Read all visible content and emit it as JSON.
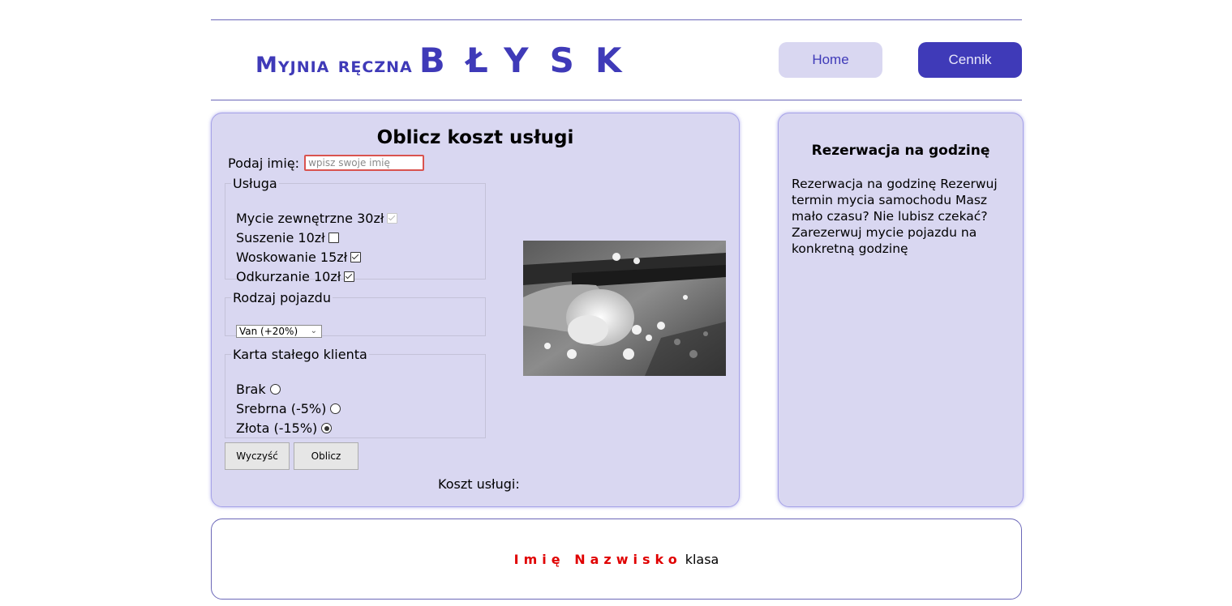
{
  "header": {
    "brand_small": "Myjnia ręczna",
    "brand_big": "BŁYSK",
    "nav": [
      {
        "label": "Home"
      },
      {
        "label": "Cennik"
      }
    ]
  },
  "form": {
    "title": "Oblicz koszt usługi",
    "name_label": "Podaj imię:",
    "name_placeholder": "wpisz swoje imię",
    "name_value": "",
    "services_legend": "Usługa",
    "services": [
      {
        "label": "Mycie zewnętrzne 30zł",
        "checked": true,
        "disabled": true
      },
      {
        "label": "Suszenie 10zł",
        "checked": false,
        "disabled": false
      },
      {
        "label": "Woskowanie 15zł",
        "checked": true,
        "disabled": false
      },
      {
        "label": "Odkurzanie 10zł",
        "checked": true,
        "disabled": false
      }
    ],
    "vehicle_legend": "Rodzaj pojazdu",
    "vehicle_selected": "Van (+20%)",
    "card_legend": "Karta stałego klienta",
    "cards": [
      {
        "label": "Brak",
        "checked": false
      },
      {
        "label": "Srebrna (-5%)",
        "checked": false
      },
      {
        "label": "Złota (-15%)",
        "checked": true
      }
    ],
    "clear_label": "Wyczyść",
    "calc_label": "Oblicz",
    "cost_label": "Koszt usługi:"
  },
  "reservation": {
    "title": "Rezerwacja na godzinę",
    "text": "Rezerwacja na godzinę Rezerwuj termin mycia samochodu Masz mało czasu? Nie lubisz czekać? Zarezerwuj mycie pojazdu na konkretną godzinę"
  },
  "footer": {
    "author": "Imię Nazwisko",
    "class_label": "klasa"
  },
  "colors": {
    "accent": "#3f3ab8",
    "panel_bg": "#d9d7f1",
    "author": "#e00000"
  }
}
